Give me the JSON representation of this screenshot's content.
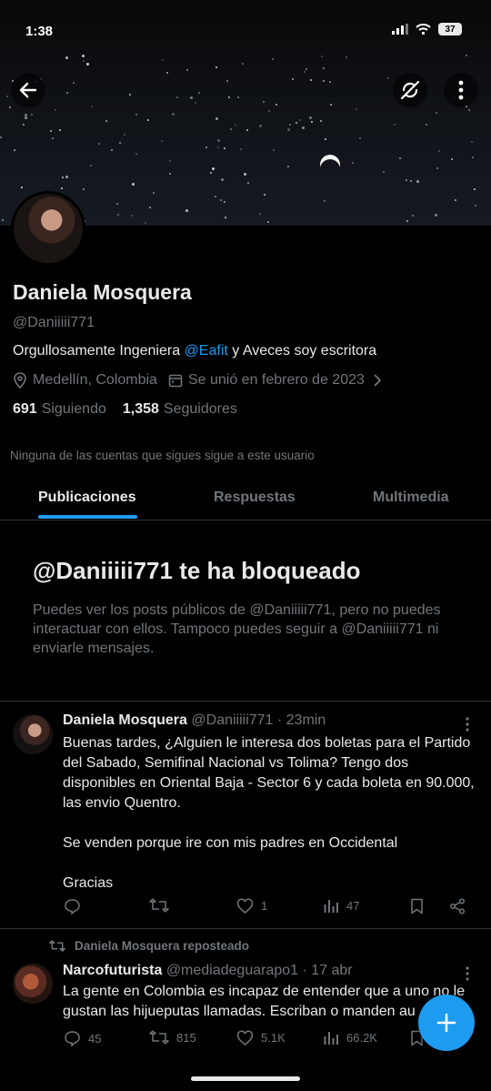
{
  "status_bar": {
    "time": "1:38",
    "battery": "37"
  },
  "profile": {
    "name": "Daniela Mosquera",
    "handle": "@Daniiiii771",
    "bio_prefix": "Orgullosamente Ingeniera ",
    "bio_mention": "@Eafit",
    "bio_suffix": " y Aveces soy escritora",
    "location": "Medellín, Colombia",
    "joined": "Se unió en febrero de 2023",
    "following_count": "691",
    "following_label": "Siguiendo",
    "followers_count": "1,358",
    "followers_label": "Seguidores",
    "mutual_note": "Ninguna de las cuentas que sigues sigue a este usuario"
  },
  "tabs": [
    {
      "label": "Publicaciones",
      "active": true
    },
    {
      "label": "Respuestas",
      "active": false
    },
    {
      "label": "Multimedia",
      "active": false
    }
  ],
  "blocked": {
    "title": "@Daniiiii771 te ha bloqueado",
    "description": "Puedes ver los posts públicos de @Daniiiii771, pero no puedes interactuar con ellos. Tampoco puedes seguir a @Daniiiii771 ni enviarle mensajes."
  },
  "posts": [
    {
      "name": "Daniela Mosquera",
      "meta": "@Daniiiii771 · 23min",
      "text": "Buenas tardes, ¿Alguien le interesa dos boletas para el Partido del Sabado, Semifinal Nacional vs Tolima? Tengo dos disponibles en Oriental Baja - Sector 6 y cada boleta en 90.000, las envio Quentro.\n\nSe venden porque ire con mis padres en Occidental\n\nGracias",
      "replies": "",
      "reposts": "",
      "likes": "1",
      "views": "47"
    },
    {
      "repost_note": "Daniela Mosquera reposteado",
      "name": "Narcofuturista",
      "meta": "@mediadeguarapo1 · 17 abr",
      "text": "La gente en Colombia es incapaz de entender que a uno no le gustan las hijueputas llamadas. Escriban o manden au",
      "replies": "45",
      "reposts": "815",
      "likes": "5.1K",
      "views": "66.2K"
    }
  ],
  "colors": {
    "accent": "#1d9bf0",
    "muted": "#71767b",
    "text": "#e7e9ea",
    "background": "#000000"
  },
  "icons": [
    "back-arrow-icon",
    "no-sync-icon",
    "more-vertical-icon",
    "location-pin-icon",
    "calendar-icon",
    "chevron-right-icon",
    "reply-icon",
    "repost-icon",
    "like-icon",
    "views-icon",
    "bookmark-icon",
    "share-icon",
    "compose-plus-icon"
  ]
}
